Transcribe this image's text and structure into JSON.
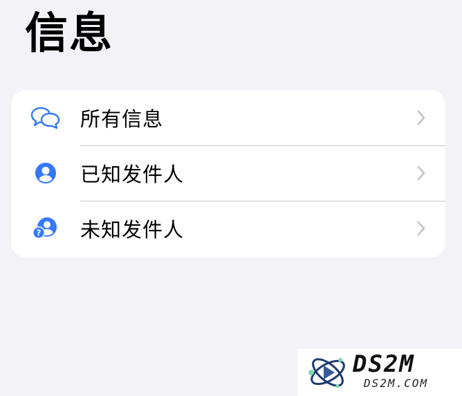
{
  "header": {
    "title": "信息"
  },
  "list": {
    "items": [
      {
        "label": "所有信息",
        "icon": "chat-bubbles-icon"
      },
      {
        "label": "已知发件人",
        "icon": "person-circle-icon"
      },
      {
        "label": "未知发件人",
        "icon": "person-question-icon"
      }
    ]
  },
  "watermark": {
    "brand": "DS2M",
    "domain": "DS2M.COM"
  },
  "colors": {
    "accent": "#3478f6",
    "background": "#f2f2f7",
    "separator": "#c6c6c8",
    "chevron": "#c4c4c7"
  }
}
